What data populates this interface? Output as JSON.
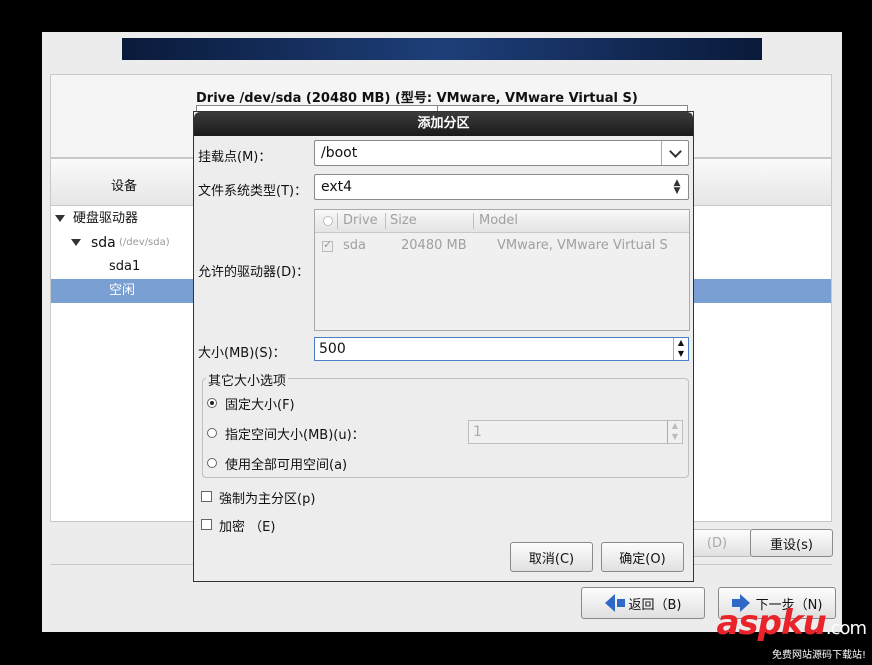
{
  "installer": {
    "drive_title": "Drive /dev/sda (20480 MB) (型号: VMware, VMware Virtual S)",
    "tree_header": "设备",
    "tree": [
      {
        "label": "硬盘驱动器",
        "sub": ""
      },
      {
        "label": "sda",
        "sub": "(/dev/sda)"
      },
      {
        "label": "sda1",
        "sub": ""
      },
      {
        "label": "空闲",
        "sub": ""
      }
    ],
    "delete_button": "(D)",
    "reset_button": "重设(s)",
    "back_button": "返回（B)",
    "next_button": "下一步（N)"
  },
  "dialog": {
    "title": "添加分区",
    "mount_label": "挂载点(M)：",
    "mount_value": "/boot",
    "fs_label": "文件系统类型(T)：",
    "fs_value": "ext4",
    "drives_label": "允许的驱动器(D)：",
    "drives_columns": [
      "Drive",
      "Size",
      "Model"
    ],
    "drives_rows": [
      {
        "drive": "sda",
        "size": "20480 MB",
        "model": "VMware, VMware Virtual S",
        "checked": true
      }
    ],
    "size_label": "大小(MB)(S)：",
    "size_value": "500",
    "other_size_title": "其它大小选项",
    "options": [
      {
        "label": "固定大小(F)",
        "selected": true
      },
      {
        "label": "指定空间大小(MB)(u)：",
        "selected": false
      },
      {
        "label": "使用全部可用空间(a)",
        "selected": false
      }
    ],
    "max_size_value": "1",
    "force_primary_label": "強制为主分区(p)",
    "encrypt_label": "加密 （E)",
    "cancel_button": "取消(C)",
    "ok_button": "确定(O)"
  },
  "watermark": {
    "logo_main": "aspku",
    "logo_tld": ".com",
    "tagline": "免费网站源码下载站!"
  },
  "colors": {
    "selection": "#7a9fd3",
    "accent_arrow": "#2f68c6",
    "watermark_red": "#e8242a"
  }
}
